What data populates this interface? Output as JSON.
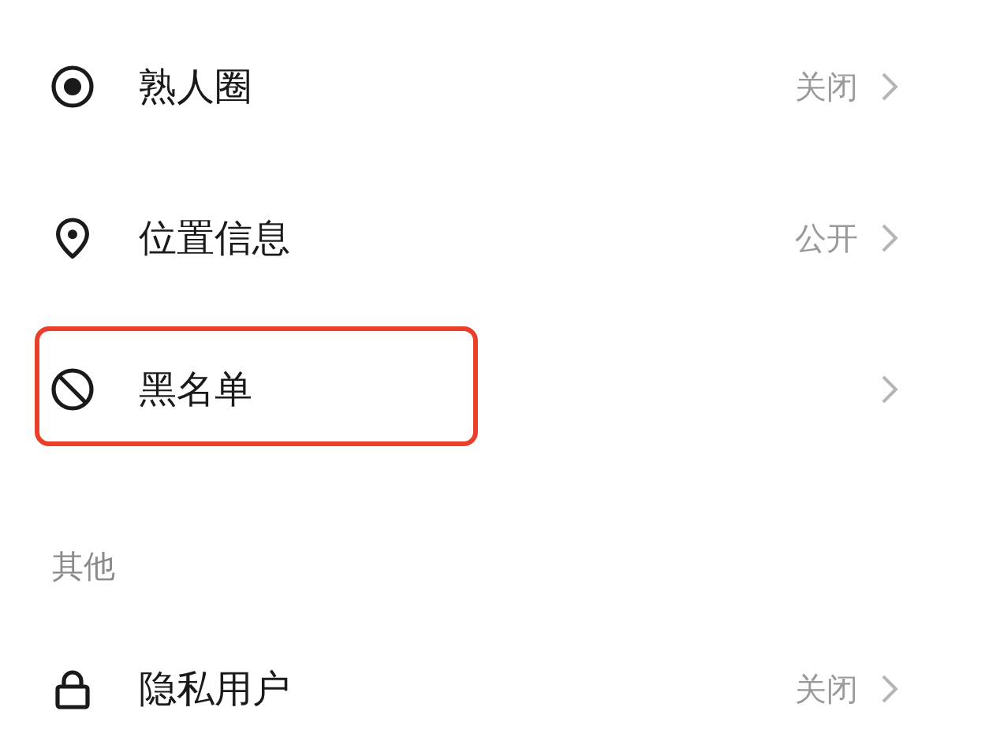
{
  "items": [
    {
      "kind": "row",
      "label": "熟人圈",
      "value": "关闭",
      "highlighted": false
    },
    {
      "kind": "row",
      "label": "位置信息",
      "value": "公开",
      "highlighted": false
    },
    {
      "kind": "row",
      "label": "黑名单",
      "highlighted": true
    },
    {
      "kind": "header",
      "label": "其他"
    },
    {
      "kind": "row",
      "label": "隐私用户",
      "value": "关闭",
      "highlighted": false
    }
  ]
}
